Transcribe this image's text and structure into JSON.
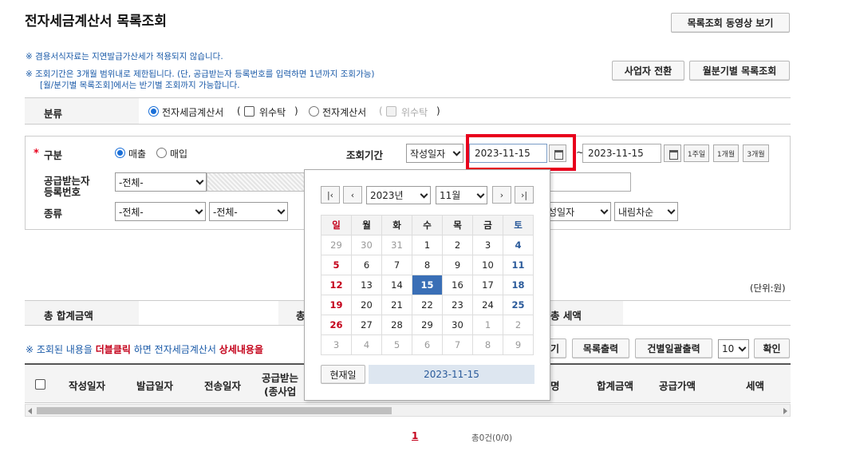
{
  "page_title": "전자세금계산서 목록조회",
  "video_button": "목록조회 동영상 보기",
  "notices": {
    "n1": "※ 겸용서식자료는 지연발급가산세가 적용되지 않습니다.",
    "n2": "※ 조회기간은 3개월 범위내로 제한됩니다. (단, 공급받는자 등록번호를 입력하면 1년까지 조회가능)",
    "n3": "[월/분기별 목록조회]에서는 반기별 조회까지 가능합니다."
  },
  "top_buttons": {
    "switch_business": "사업자 전환",
    "monthly_list": "월분기별 목록조회"
  },
  "category": {
    "label": "분류",
    "opt1": "전자세금계산서",
    "paren_open": "(",
    "consign": "위수탁",
    "paren_close": ")",
    "opt2": "전자계산서"
  },
  "form": {
    "required_mark": "*",
    "type_label": "구분",
    "sales": "매출",
    "purchase": "매입",
    "period_label": "조회기간",
    "date_type": "작성일자",
    "start_date": "2023-11-15",
    "tilde": "~",
    "end_date": "2023-11-15",
    "btn_1w": "1주일",
    "btn_1m": "1개월",
    "btn_3m": "3개월",
    "receiver_label_1": "공급받는자",
    "receiver_label_2": "등록번호",
    "receiver_select": "-전체-",
    "kind_label": "종류",
    "kind_select1": "-전체-",
    "kind_select2": "-전체-",
    "sort_field": "성일자",
    "sort_order": "내림차순"
  },
  "unit_label": "(단위:원)",
  "summary": {
    "total_amount": "총 합계금액",
    "total_partial": "총",
    "total_tax": "총 세액"
  },
  "hint": {
    "prefix": "※ 조회된 내용을",
    "dbl": "더블클릭",
    "mid": "하면 전자세금계산서",
    "detail": "상세내용을"
  },
  "list_buttons": {
    "partial": "기",
    "print_list": "목록출력",
    "batch_print": "건별일괄출력",
    "page_size": "10",
    "confirm": "확인"
  },
  "table_headers": [
    "작성일자",
    "발급일자",
    "전송일자",
    "공급받는",
    "(종사업",
    "명",
    "합계금액",
    "공급가액",
    "세액"
  ],
  "pagination": {
    "page": "1",
    "total": "총0건(0/0)"
  },
  "calendar": {
    "year": "2023년",
    "month": "11월",
    "weekdays": [
      "일",
      "월",
      "화",
      "수",
      "목",
      "금",
      "토"
    ],
    "weeks": [
      [
        "29",
        "30",
        "31",
        "1",
        "2",
        "3",
        "4"
      ],
      [
        "5",
        "6",
        "7",
        "8",
        "9",
        "10",
        "11"
      ],
      [
        "12",
        "13",
        "14",
        "15",
        "16",
        "17",
        "18"
      ],
      [
        "19",
        "20",
        "21",
        "22",
        "23",
        "24",
        "25"
      ],
      [
        "26",
        "27",
        "28",
        "29",
        "30",
        "1",
        "2"
      ],
      [
        "3",
        "4",
        "5",
        "6",
        "7",
        "8",
        "9"
      ]
    ],
    "today_button": "현재일",
    "selected_display": "2023-11-15",
    "highlight_color": "#3a6fb6"
  },
  "colors": {
    "notice_blue": "#1a5aa8",
    "red_highlight": "#e8001c",
    "sunday_red": "#c4001a",
    "saturday_blue": "#2a5a9a"
  }
}
